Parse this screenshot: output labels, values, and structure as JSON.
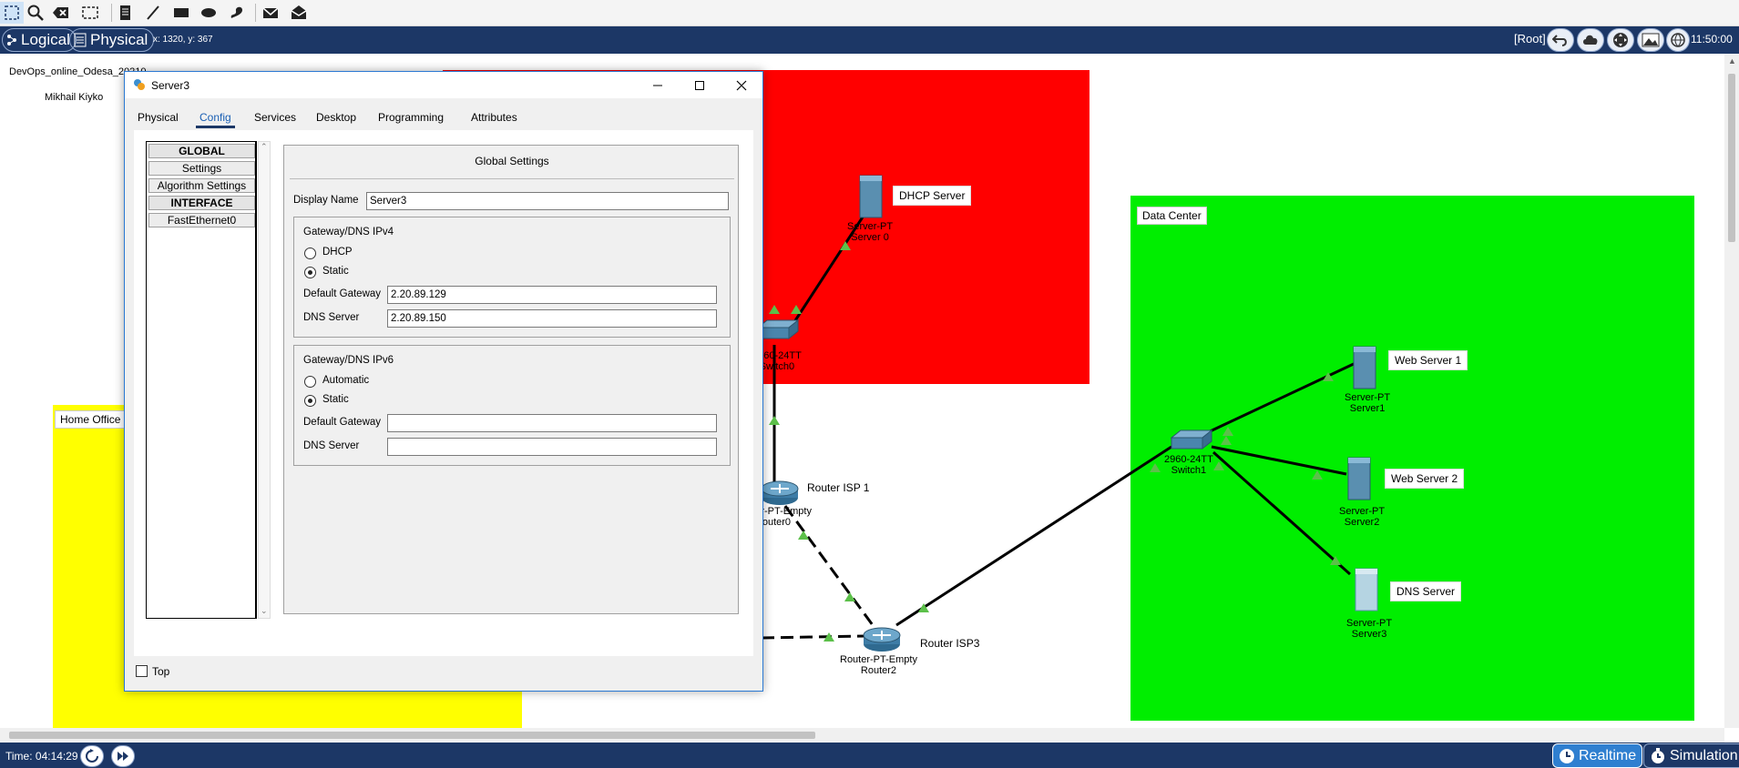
{
  "toolbar": {
    "icons": [
      "select-icon",
      "zoom-icon",
      "delete-icon",
      "resize-icon",
      "note-icon",
      "line-icon",
      "rectangle-icon",
      "ellipse-icon",
      "freeform-icon",
      "add-pdu-icon",
      "open-pdu-icon"
    ]
  },
  "navbar": {
    "logical_label": "Logical",
    "physical_label": "Physical",
    "coordinates": "x: 1320, y: 367",
    "root_label": "[Root]",
    "clock": "11:50:00"
  },
  "workspace": {
    "top_note_1": "DevOps_online_Odesa_20210",
    "top_note_2": "Mikhail Kiyko",
    "areas": {
      "home_office": "Home Office",
      "data_center": "Data Center"
    },
    "colors": {
      "red_area": "#ff0000",
      "yellow_area": "#ffff00",
      "green_area": "#00ee00",
      "link_indicator": "#5cc04a"
    },
    "devices": {
      "dhcp_server_name": "DHCP Server",
      "server0_type": "Server-PT",
      "server0_id": "Server 0",
      "switch0_type": "2960-24TT",
      "switch0_id": "Switch0",
      "router0_name": "Router ISP 1",
      "router0_type": "Router-PT-Empty",
      "router0_id": "Router0",
      "router2_name": "Router ISP3",
      "router2_type": "Router-PT-Empty",
      "router2_id": "Router2",
      "switch1_type": "2960-24TT",
      "switch1_id": "Switch1",
      "web1_name": "Web Server 1",
      "web1_type": "Server-PT",
      "web1_id": "Server1",
      "web2_name": "Web Server 2",
      "web2_type": "Server-PT",
      "web2_id": "Server2",
      "dns_name": "DNS Server",
      "dns_type": "Server-PT",
      "dns_id": "Server3"
    }
  },
  "dialog": {
    "title": "Server3",
    "tabs": [
      "Physical",
      "Config",
      "Services",
      "Desktop",
      "Programming",
      "Attributes"
    ],
    "active_tab": "Config",
    "left_list": {
      "global_header": "GLOBAL",
      "settings": "Settings",
      "algorithm_settings": "Algorithm Settings",
      "interface_header": "INTERFACE",
      "fastethernet": "FastEthernet0"
    },
    "panel_title": "Global Settings",
    "display_name_label": "Display Name",
    "display_name_value": "Server3",
    "ipv4": {
      "title": "Gateway/DNS IPv4",
      "dhcp_label": "DHCP",
      "static_label": "Static",
      "selected": "Static",
      "gateway_label": "Default Gateway",
      "gateway_value": "2.20.89.129",
      "dns_label": "DNS Server",
      "dns_value": "2.20.89.150"
    },
    "ipv6": {
      "title": "Gateway/DNS IPv6",
      "automatic_label": "Automatic",
      "static_label": "Static",
      "selected": "Static",
      "gateway_label": "Default Gateway",
      "gateway_value": "",
      "dns_label": "DNS Server",
      "dns_value": ""
    },
    "top_label": "Top",
    "top_checked": false
  },
  "bottombar": {
    "time": "Time: 04:14:29",
    "realtime_label": "Realtime",
    "simulation_label": "Simulation"
  }
}
